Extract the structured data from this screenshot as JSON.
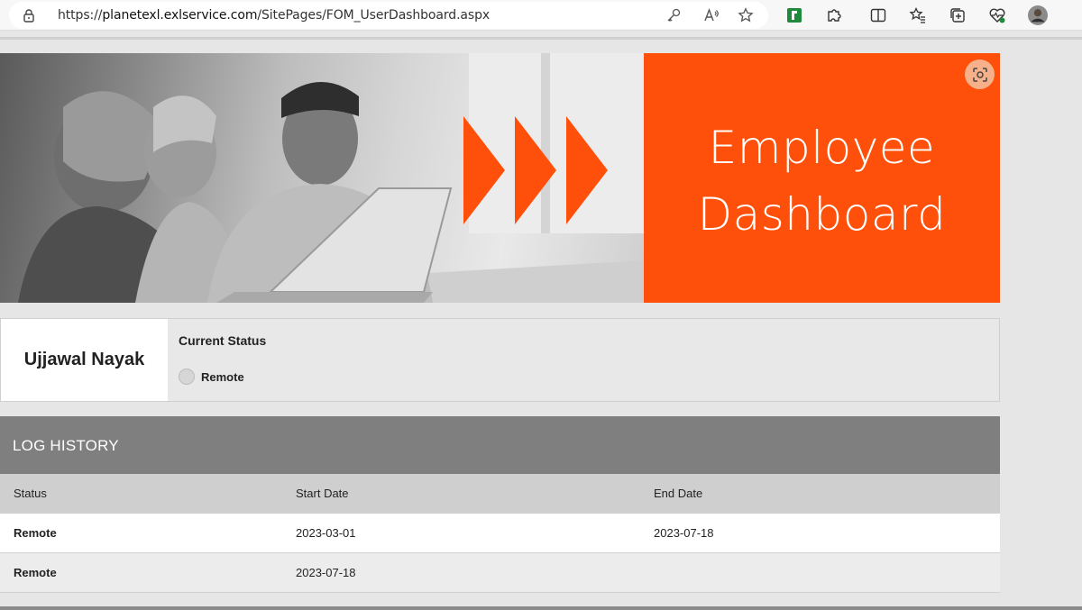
{
  "browser": {
    "url_prefix": "https://",
    "url_host": "planetexl.exlservice.com",
    "url_path": "/SitePages/FOM_UserDashboard.aspx"
  },
  "banner": {
    "title_line1": "Employee",
    "title_line2": "Dashboard",
    "accent_color": "#fe500a"
  },
  "user": {
    "name": "Ujjawal Nayak"
  },
  "status": {
    "label": "Current Status",
    "selected": "Remote"
  },
  "log_history": {
    "title": "LOG HISTORY",
    "columns": [
      "Status",
      "Start Date",
      "End Date"
    ],
    "rows": [
      [
        "Remote",
        "2023-03-01",
        "2023-07-18"
      ],
      [
        "Remote",
        "2023-07-18",
        ""
      ]
    ]
  }
}
